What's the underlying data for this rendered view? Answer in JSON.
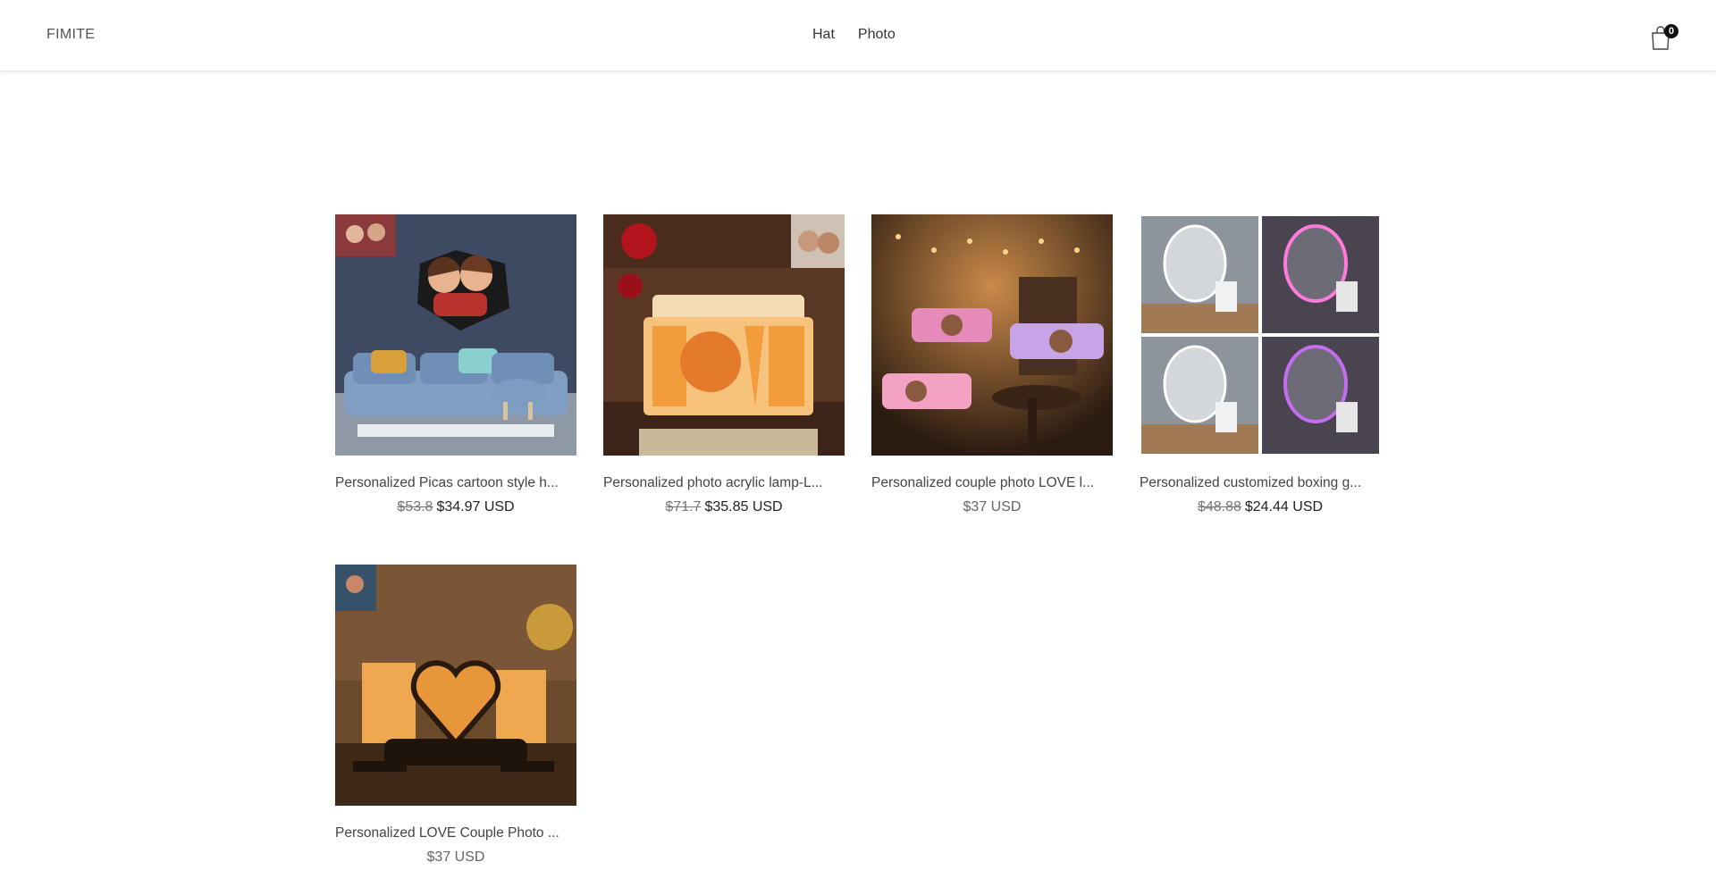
{
  "header": {
    "logo": "FIMITE",
    "nav": [
      {
        "label": "Hat"
      },
      {
        "label": "Photo"
      }
    ],
    "cart_count": "0"
  },
  "products": [
    {
      "title": "Personalized Picas cartoon style h...",
      "old_price": "$53.8",
      "price": "$34.97 USD"
    },
    {
      "title": "Personalized photo acrylic lamp-L...",
      "old_price": "$71.7",
      "price": "$35.85 USD"
    },
    {
      "title": "Personalized couple photo LOVE l...",
      "old_price": "",
      "price": "$37 USD"
    },
    {
      "title": "Personalized customized boxing g...",
      "old_price": "$48.88",
      "price": "$24.44 USD"
    },
    {
      "title": "Personalized LOVE Couple Photo ...",
      "old_price": "",
      "price": "$37 USD"
    }
  ],
  "colors": {
    "accent": "#111111",
    "text": "#333333"
  }
}
